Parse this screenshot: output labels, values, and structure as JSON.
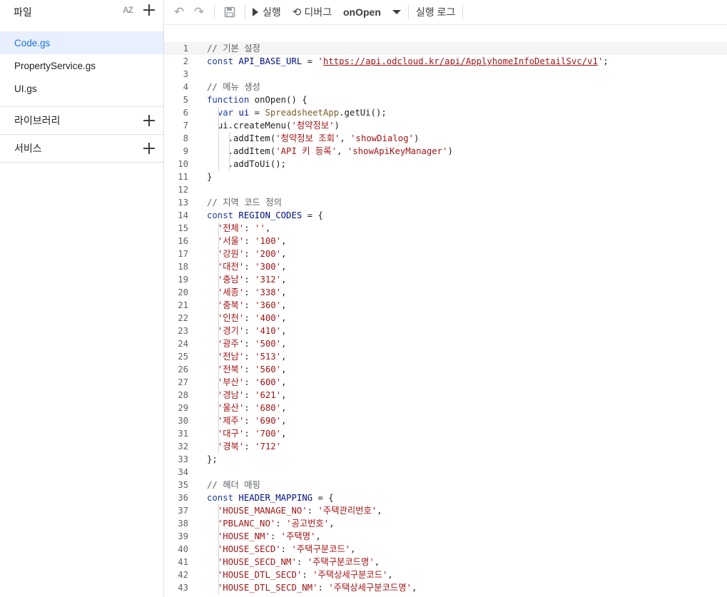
{
  "sidebar": {
    "title": "파일",
    "sort_label": "AZ",
    "files": [
      {
        "name": "Code.gs",
        "active": true
      },
      {
        "name": "PropertyService.gs",
        "active": false
      },
      {
        "name": "UI.gs",
        "active": false
      }
    ],
    "library_label": "라이브러리",
    "services_label": "서비스"
  },
  "toolbar": {
    "undo_icon": "undo-icon",
    "redo_icon": "redo-icon",
    "save_icon": "save-icon",
    "run_label": "실행",
    "debug_label": "디버그",
    "function_name": "onOpen",
    "log_label": "실행 로그"
  },
  "editor": {
    "current_line": 1,
    "lines": [
      [
        [
          "c",
          "// 기본 설정"
        ]
      ],
      [
        [
          "k",
          "const "
        ],
        [
          "i",
          "API_BASE_URL"
        ],
        [
          "p",
          " = "
        ],
        [
          "s",
          "'"
        ],
        [
          "u",
          "https://api.odcloud.kr/api/ApplyhomeInfoDetailSvc/v1"
        ],
        [
          "s",
          "'"
        ],
        [
          "p",
          ";"
        ]
      ],
      [],
      [
        [
          "c",
          "// 메뉴 생성"
        ]
      ],
      [
        [
          "k",
          "function "
        ],
        [
          "p",
          "onOpen() {"
        ]
      ],
      [
        [
          "p",
          "  "
        ],
        [
          "k",
          "var "
        ],
        [
          "i",
          "ui"
        ],
        [
          "p",
          " = "
        ],
        [
          "f",
          "SpreadsheetApp"
        ],
        [
          "p",
          ".getUi();"
        ]
      ],
      [
        [
          "p",
          "  ui.createMenu("
        ],
        [
          "s",
          "'청약정보'"
        ],
        [
          "p",
          ")"
        ]
      ],
      [
        [
          "p",
          "    .addItem("
        ],
        [
          "s",
          "'청약정보 조회'"
        ],
        [
          "p",
          ", "
        ],
        [
          "s",
          "'showDialog'"
        ],
        [
          "p",
          ")"
        ]
      ],
      [
        [
          "p",
          "    .addItem("
        ],
        [
          "s",
          "'API 키 등록'"
        ],
        [
          "p",
          ", "
        ],
        [
          "s",
          "'showApiKeyManager'"
        ],
        [
          "p",
          ")"
        ]
      ],
      [
        [
          "p",
          "    .addToUi();"
        ]
      ],
      [
        [
          "p",
          "}"
        ]
      ],
      [],
      [
        [
          "c",
          "// 지역 코드 정의"
        ]
      ],
      [
        [
          "k",
          "const "
        ],
        [
          "i",
          "REGION_CODES"
        ],
        [
          "p",
          " = {"
        ]
      ],
      [
        [
          "p",
          "  "
        ],
        [
          "s",
          "'전체'"
        ],
        [
          "p",
          ": "
        ],
        [
          "s",
          "''"
        ],
        [
          "p",
          ","
        ]
      ],
      [
        [
          "p",
          "  "
        ],
        [
          "s",
          "'서울'"
        ],
        [
          "p",
          ": "
        ],
        [
          "s",
          "'100'"
        ],
        [
          "p",
          ","
        ]
      ],
      [
        [
          "p",
          "  "
        ],
        [
          "s",
          "'강원'"
        ],
        [
          "p",
          ": "
        ],
        [
          "s",
          "'200'"
        ],
        [
          "p",
          ","
        ]
      ],
      [
        [
          "p",
          "  "
        ],
        [
          "s",
          "'대전'"
        ],
        [
          "p",
          ": "
        ],
        [
          "s",
          "'300'"
        ],
        [
          "p",
          ","
        ]
      ],
      [
        [
          "p",
          "  "
        ],
        [
          "s",
          "'충남'"
        ],
        [
          "p",
          ": "
        ],
        [
          "s",
          "'312'"
        ],
        [
          "p",
          ","
        ]
      ],
      [
        [
          "p",
          "  "
        ],
        [
          "s",
          "'세종'"
        ],
        [
          "p",
          ": "
        ],
        [
          "s",
          "'338'"
        ],
        [
          "p",
          ","
        ]
      ],
      [
        [
          "p",
          "  "
        ],
        [
          "s",
          "'충북'"
        ],
        [
          "p",
          ": "
        ],
        [
          "s",
          "'360'"
        ],
        [
          "p",
          ","
        ]
      ],
      [
        [
          "p",
          "  "
        ],
        [
          "s",
          "'인천'"
        ],
        [
          "p",
          ": "
        ],
        [
          "s",
          "'400'"
        ],
        [
          "p",
          ","
        ]
      ],
      [
        [
          "p",
          "  "
        ],
        [
          "s",
          "'경기'"
        ],
        [
          "p",
          ": "
        ],
        [
          "s",
          "'410'"
        ],
        [
          "p",
          ","
        ]
      ],
      [
        [
          "p",
          "  "
        ],
        [
          "s",
          "'광주'"
        ],
        [
          "p",
          ": "
        ],
        [
          "s",
          "'500'"
        ],
        [
          "p",
          ","
        ]
      ],
      [
        [
          "p",
          "  "
        ],
        [
          "s",
          "'전남'"
        ],
        [
          "p",
          ": "
        ],
        [
          "s",
          "'513'"
        ],
        [
          "p",
          ","
        ]
      ],
      [
        [
          "p",
          "  "
        ],
        [
          "s",
          "'전북'"
        ],
        [
          "p",
          ": "
        ],
        [
          "s",
          "'560'"
        ],
        [
          "p",
          ","
        ]
      ],
      [
        [
          "p",
          "  "
        ],
        [
          "s",
          "'부산'"
        ],
        [
          "p",
          ": "
        ],
        [
          "s",
          "'600'"
        ],
        [
          "p",
          ","
        ]
      ],
      [
        [
          "p",
          "  "
        ],
        [
          "s",
          "'경남'"
        ],
        [
          "p",
          ": "
        ],
        [
          "s",
          "'621'"
        ],
        [
          "p",
          ","
        ]
      ],
      [
        [
          "p",
          "  "
        ],
        [
          "s",
          "'울산'"
        ],
        [
          "p",
          ": "
        ],
        [
          "s",
          "'680'"
        ],
        [
          "p",
          ","
        ]
      ],
      [
        [
          "p",
          "  "
        ],
        [
          "s",
          "'제주'"
        ],
        [
          "p",
          ": "
        ],
        [
          "s",
          "'690'"
        ],
        [
          "p",
          ","
        ]
      ],
      [
        [
          "p",
          "  "
        ],
        [
          "s",
          "'대구'"
        ],
        [
          "p",
          ": "
        ],
        [
          "s",
          "'700'"
        ],
        [
          "p",
          ","
        ]
      ],
      [
        [
          "p",
          "  "
        ],
        [
          "s",
          "'경북'"
        ],
        [
          "p",
          ": "
        ],
        [
          "s",
          "'712'"
        ]
      ],
      [
        [
          "p",
          "};"
        ]
      ],
      [],
      [
        [
          "c",
          "// 헤더 매핑"
        ]
      ],
      [
        [
          "k",
          "const "
        ],
        [
          "i",
          "HEADER_MAPPING"
        ],
        [
          "p",
          " = {"
        ]
      ],
      [
        [
          "p",
          "  "
        ],
        [
          "s",
          "'HOUSE_MANAGE_NO'"
        ],
        [
          "p",
          ": "
        ],
        [
          "s",
          "'주택관리번호'"
        ],
        [
          "p",
          ","
        ]
      ],
      [
        [
          "p",
          "  "
        ],
        [
          "s",
          "'PBLANC_NO'"
        ],
        [
          "p",
          ": "
        ],
        [
          "s",
          "'공고번호'"
        ],
        [
          "p",
          ","
        ]
      ],
      [
        [
          "p",
          "  "
        ],
        [
          "s",
          "'HOUSE_NM'"
        ],
        [
          "p",
          ": "
        ],
        [
          "s",
          "'주택명'"
        ],
        [
          "p",
          ","
        ]
      ],
      [
        [
          "p",
          "  "
        ],
        [
          "s",
          "'HOUSE_SECD'"
        ],
        [
          "p",
          ": "
        ],
        [
          "s",
          "'주택구분코드'"
        ],
        [
          "p",
          ","
        ]
      ],
      [
        [
          "p",
          "  "
        ],
        [
          "s",
          "'HOUSE_SECD_NM'"
        ],
        [
          "p",
          ": "
        ],
        [
          "s",
          "'주택구분코드명'"
        ],
        [
          "p",
          ","
        ]
      ],
      [
        [
          "p",
          "  "
        ],
        [
          "s",
          "'HOUSE_DTL_SECD'"
        ],
        [
          "p",
          ": "
        ],
        [
          "s",
          "'주택상세구분코드'"
        ],
        [
          "p",
          ","
        ]
      ],
      [
        [
          "p",
          "  "
        ],
        [
          "s",
          "'HOUSE_DTL_SECD_NM'"
        ],
        [
          "p",
          ": "
        ],
        [
          "s",
          "'주택상세구분코드명'"
        ],
        [
          "p",
          ","
        ]
      ]
    ]
  }
}
